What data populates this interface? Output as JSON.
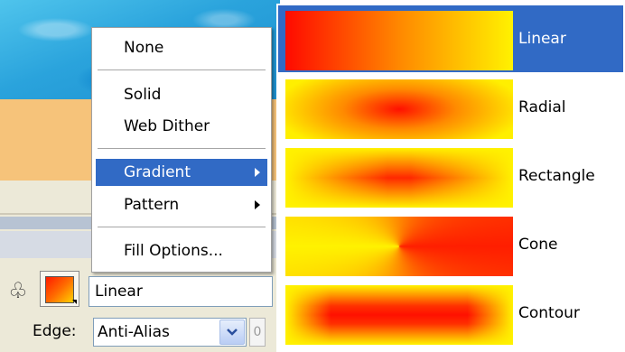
{
  "menu": {
    "items": [
      {
        "label": "None"
      },
      {
        "label": "Solid"
      },
      {
        "label": "Web Dither"
      },
      {
        "label": "Gradient"
      },
      {
        "label": "Pattern"
      },
      {
        "label": "Fill Options..."
      }
    ],
    "highlighted": "Gradient"
  },
  "submenu": {
    "items": [
      {
        "label": "Linear"
      },
      {
        "label": "Radial"
      },
      {
        "label": "Rectangle"
      },
      {
        "label": "Cone"
      },
      {
        "label": "Contour"
      }
    ],
    "highlighted": "Linear"
  },
  "toolbar": {
    "fill_type_value": "Linear",
    "edge_label": "Edge:",
    "edge_value": "Anti-Alias",
    "feather_value": "0"
  },
  "colors": {
    "highlight": "#316ac5",
    "gradient_start": "#ff0a00",
    "gradient_end": "#fff200"
  },
  "icons": {
    "bucket": "paint-bucket-icon",
    "submenu_arrow": "chevron-right-icon",
    "dropdown": "chevron-down-icon"
  }
}
